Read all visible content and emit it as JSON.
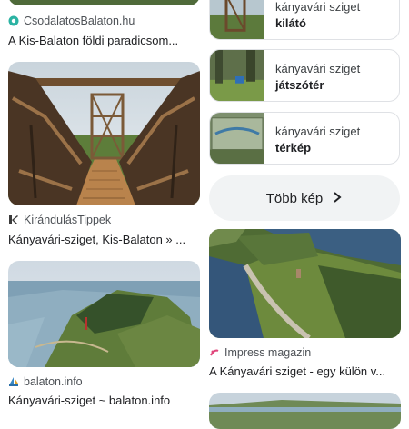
{
  "left": {
    "top_result": {
      "source": "CsodalatosBalaton.hu",
      "title": "A Kis-Balaton földi paradicsom..."
    },
    "bridge_result": {
      "source": "KirándulásTippek",
      "title": "Kányavári-sziget, Kis-Balaton » ..."
    },
    "island_result": {
      "source": "balaton.info",
      "title": "Kányavári-sziget ~ balaton.info"
    }
  },
  "right": {
    "chips": [
      {
        "line1": "kányavári sziget",
        "line2": "kilátó"
      },
      {
        "line1": "kányavári sziget",
        "line2": "játszótér"
      },
      {
        "line1": "kányavári sziget",
        "line2": "térkép"
      }
    ],
    "more_button": {
      "label": "Több kép"
    },
    "aerial_result": {
      "source": "Impress magazin",
      "title": "A Kányavári sziget - egy külön v..."
    }
  },
  "colors": {
    "text": "#202124",
    "secondary": "#4d5156",
    "chip_border": "#dfe1e5",
    "button_bg": "#f1f3f4"
  },
  "icons": {
    "csodalatos": "teal-circle-icon",
    "kirandulas": "k-logo-icon",
    "balaton_info": "sailboat-icon",
    "impress": "impress-logo-icon",
    "more": "chevron-right-icon"
  }
}
